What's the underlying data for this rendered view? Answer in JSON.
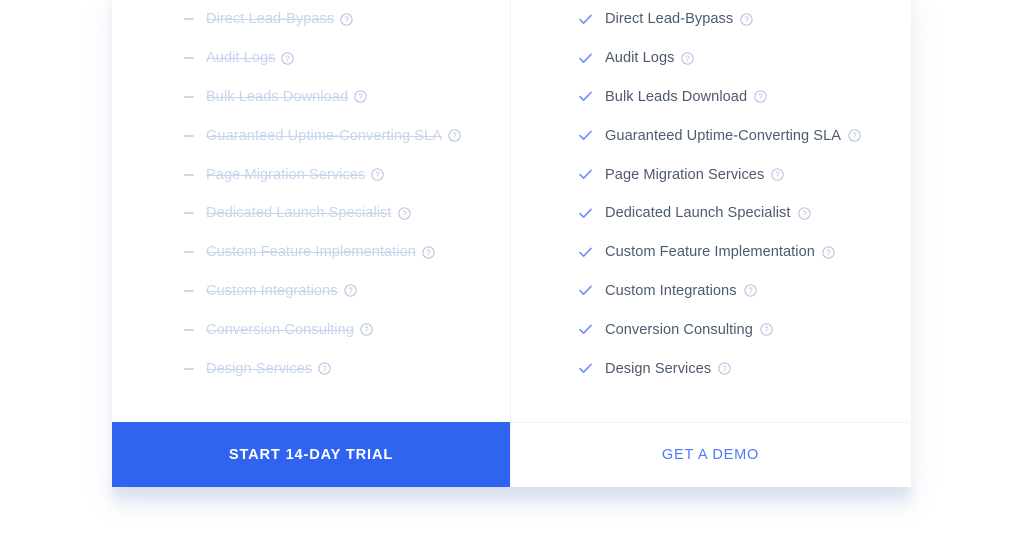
{
  "colors": {
    "primary_blue": "#2f63f0",
    "link_blue": "#4a7afd",
    "check_blue": "#6b8ff5",
    "disabled_text": "#c9d5ec",
    "enabled_text": "#4d5b6e",
    "help_icon": "#aebbd8",
    "divider": "#eef1f8",
    "card_bg": "#ffffff",
    "page_bg": "#ffffff"
  },
  "plans": [
    {
      "id": "plan-left",
      "state": "unavailable",
      "marker_icon": "dash-icon",
      "features": [
        {
          "label": "Direct Lead-Bypass",
          "help_icon": "help-circle-icon"
        },
        {
          "label": "Audit Logs",
          "help_icon": "help-circle-icon"
        },
        {
          "label": "Bulk Leads Download",
          "help_icon": "help-circle-icon"
        },
        {
          "label": "Guaranteed Uptime-Converting SLA",
          "help_icon": "help-circle-icon"
        },
        {
          "label": "Page Migration Services",
          "help_icon": "help-circle-icon"
        },
        {
          "label": "Dedicated Launch Specialist",
          "help_icon": "help-circle-icon"
        },
        {
          "label": "Custom Feature Implementation",
          "help_icon": "help-circle-icon"
        },
        {
          "label": "Custom Integrations",
          "help_icon": "help-circle-icon"
        },
        {
          "label": "Conversion Consulting",
          "help_icon": "help-circle-icon"
        },
        {
          "label": "Design Services",
          "help_icon": "help-circle-icon"
        }
      ],
      "cta": {
        "label": "START 14-DAY TRIAL",
        "style": "primary"
      }
    },
    {
      "id": "plan-right",
      "state": "available",
      "marker_icon": "check-icon",
      "features": [
        {
          "label": "Direct Lead-Bypass",
          "help_icon": "help-circle-icon"
        },
        {
          "label": "Audit Logs",
          "help_icon": "help-circle-icon"
        },
        {
          "label": "Bulk Leads Download",
          "help_icon": "help-circle-icon"
        },
        {
          "label": "Guaranteed Uptime-Converting SLA",
          "help_icon": "help-circle-icon"
        },
        {
          "label": "Page Migration Services",
          "help_icon": "help-circle-icon"
        },
        {
          "label": "Dedicated Launch Specialist",
          "help_icon": "help-circle-icon"
        },
        {
          "label": "Custom Feature Implementation",
          "help_icon": "help-circle-icon"
        },
        {
          "label": "Custom Integrations",
          "help_icon": "help-circle-icon"
        },
        {
          "label": "Conversion Consulting",
          "help_icon": "help-circle-icon"
        },
        {
          "label": "Design Services",
          "help_icon": "help-circle-icon"
        }
      ],
      "cta": {
        "label": "GET A DEMO",
        "style": "secondary"
      }
    }
  ]
}
